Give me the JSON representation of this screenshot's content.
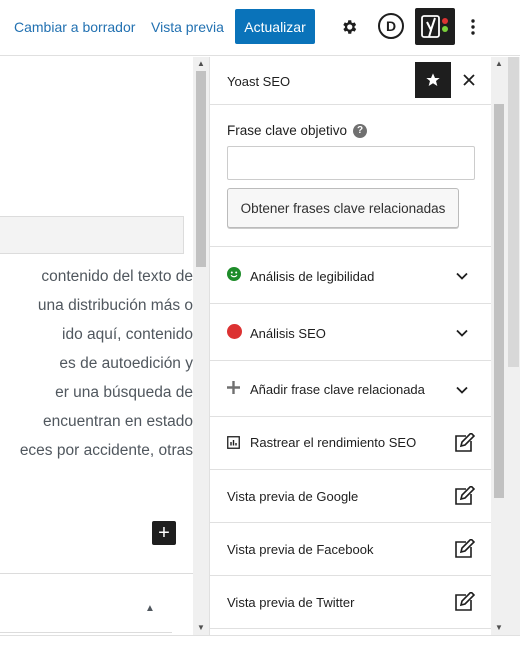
{
  "toolbar": {
    "switch_to_draft": "Cambiar a borrador",
    "preview": "Vista previa",
    "update": "Actualizar",
    "settings_icon": "gear-icon",
    "logo_letter": "D",
    "yoast_icon": "yoast-icon",
    "more_icon": "kebab-icon"
  },
  "editor": {
    "lines": [
      "contenido del texto de",
      "una distribución más o",
      "ido aquí, contenido",
      "es de autoedición y",
      "er una búsqueda de",
      "encuentran en estado",
      "eces por accidente, otras"
    ]
  },
  "sidebar": {
    "title": "Yoast SEO",
    "focus_keyphrase": {
      "label": "Frase clave objetivo",
      "value": "",
      "placeholder": "",
      "button": "Obtener frases clave relacionadas"
    },
    "sections": [
      {
        "label": "Análisis de legibilidad",
        "icon": "green-smiley-icon"
      },
      {
        "label": "Análisis SEO",
        "icon": "red-dot-icon"
      },
      {
        "label": "Añadir frase clave relacionada",
        "icon": "plus-icon"
      },
      {
        "label": "Rastrear el rendimiento SEO",
        "icon": "chart-icon"
      },
      {
        "label": "Vista previa de Google",
        "icon": "edit-icon"
      },
      {
        "label": "Vista previa de Facebook",
        "icon": "edit-icon"
      },
      {
        "label": "Vista previa de Twitter",
        "icon": "edit-icon"
      }
    ]
  },
  "colors": {
    "accent": "#0a73ba",
    "good": "#1e8c2a",
    "bad": "#dc3232",
    "dark": "#1e1e1e"
  }
}
